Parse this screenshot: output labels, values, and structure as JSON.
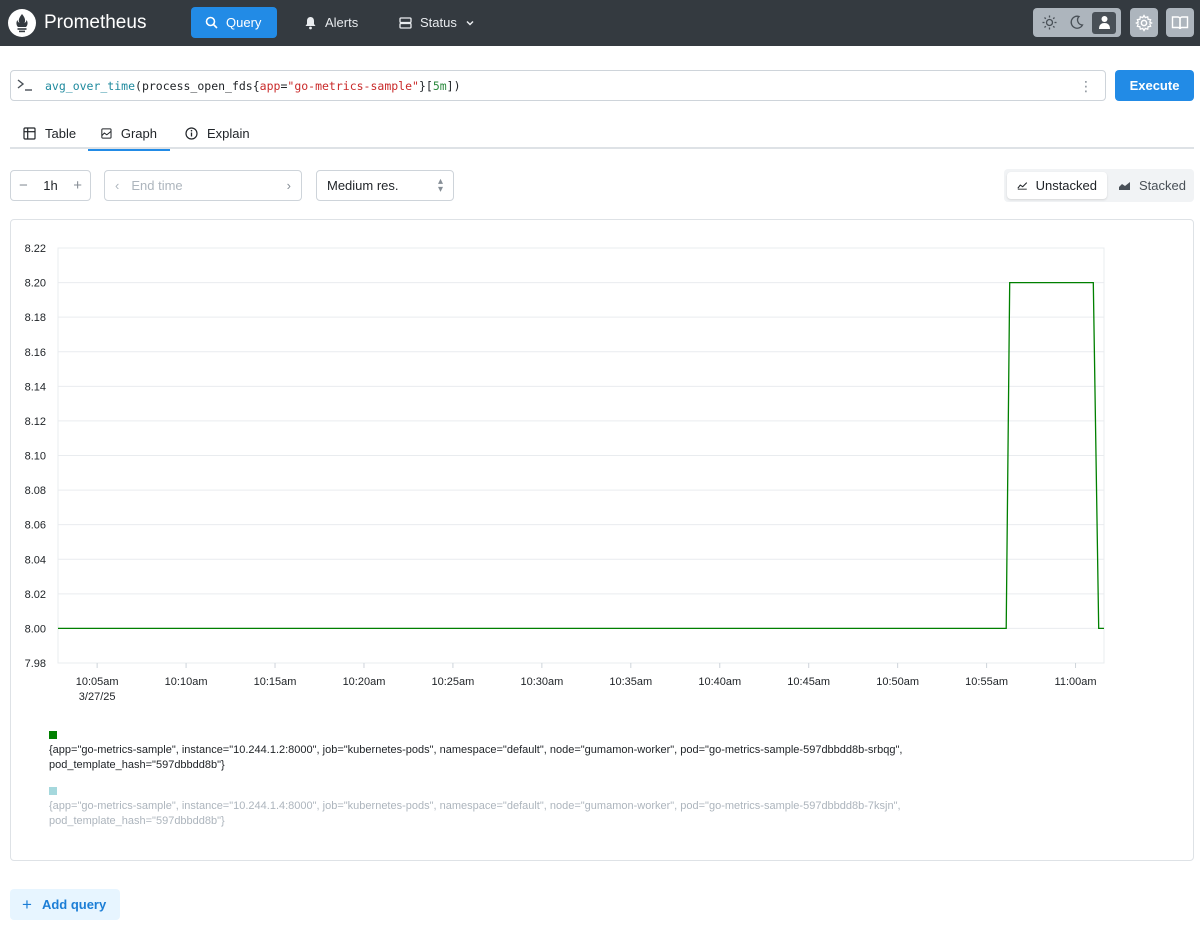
{
  "header": {
    "brand": "Prometheus",
    "nav": {
      "query": "Query",
      "alerts": "Alerts",
      "status": "Status"
    },
    "theme_modes": [
      "light-icon",
      "dark-icon",
      "auto-user-icon"
    ],
    "active_theme": "auto",
    "accent": "#228be6",
    "background": "#343a40"
  },
  "query": {
    "function": "avg_over_time",
    "metric": "process_open_fds",
    "label_name": "app",
    "label_value": "\"go-metrics-sample\"",
    "range": "5m",
    "execute_label": "Execute"
  },
  "tabs": {
    "table": "Table",
    "graph": "Graph",
    "explain": "Explain",
    "active": "Graph"
  },
  "controls": {
    "range": "1h",
    "end_time_placeholder": "End time",
    "resolution": "Medium res.",
    "unstacked_label": "Unstacked",
    "stacked_label": "Stacked",
    "active_stack_mode": "Unstacked"
  },
  "chart_data": {
    "type": "line",
    "interpolation": "step",
    "x_ticks": [
      "10:05am",
      "10:10am",
      "10:15am",
      "10:20am",
      "10:25am",
      "10:30am",
      "10:35am",
      "10:40am",
      "10:45am",
      "10:50am",
      "10:55am",
      "11:00am"
    ],
    "x_date_label": "3/27/25",
    "x_range_minutes": [
      0,
      58.8
    ],
    "y_ticks": [
      "8.22",
      "8.20",
      "8.18",
      "8.16",
      "8.14",
      "8.12",
      "8.10",
      "8.08",
      "8.06",
      "8.04",
      "8.02",
      "8.00",
      "7.98"
    ],
    "ylim": [
      7.98,
      8.22
    ],
    "grid": true,
    "series": [
      {
        "color": "#008000",
        "points": [
          [
            0,
            8.0
          ],
          [
            53.3,
            8.0
          ],
          [
            53.5,
            8.2
          ],
          [
            58.2,
            8.2
          ],
          [
            58.5,
            8.0
          ],
          [
            58.8,
            8.0
          ]
        ]
      }
    ]
  },
  "legend": [
    {
      "text": "{app=\"go-metrics-sample\", instance=\"10.244.1.2:8000\", job=\"kubernetes-pods\", namespace=\"default\", node=\"gumamon-worker\", pod=\"go-metrics-sample-597dbbdd8b-srbqg\", pod_template_hash=\"597dbbdd8b\"}",
      "color": "#008000",
      "dimmed": false
    },
    {
      "text": "{app=\"go-metrics-sample\", instance=\"10.244.1.4:8000\", job=\"kubernetes-pods\", namespace=\"default\", node=\"gumamon-worker\", pod=\"go-metrics-sample-597dbbdd8b-7ksjn\", pod_template_hash=\"597dbbdd8b\"}",
      "color": "#a5d8dd",
      "dimmed": true
    }
  ],
  "add_query_label": "Add query"
}
